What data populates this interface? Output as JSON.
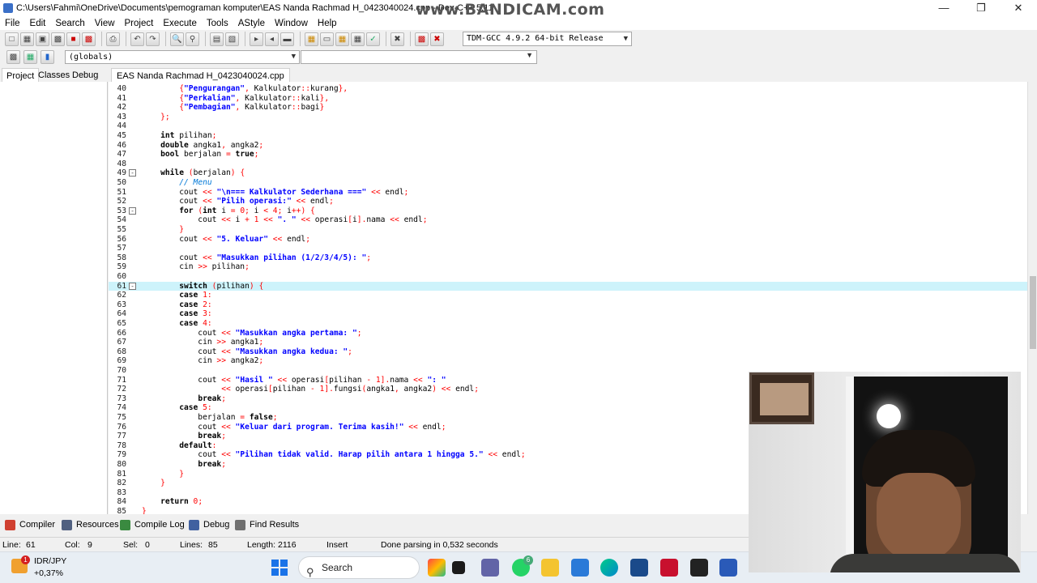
{
  "window": {
    "title": "C:\\Users\\Fahmi\\OneDrive\\Documents\\pemograman komputer\\EAS Nanda Rachmad H_0423040024.cpp - Dev-C++ 5.11",
    "watermark": "www.BANDICAM.com"
  },
  "menu": [
    "File",
    "Edit",
    "Search",
    "View",
    "Project",
    "Execute",
    "Tools",
    "AStyle",
    "Window",
    "Help"
  ],
  "toolbar": {
    "compiler": "TDM-GCC 4.9.2 64-bit Release",
    "scope": "(globals)",
    "function": ""
  },
  "left_tabs": [
    "Project",
    "Classes",
    "Debug"
  ],
  "file_tab": "EAS Nanda Rachmad H_0423040024.cpp",
  "code_lines": [
    {
      "n": "40",
      "fold": "",
      "segs": [
        [
          "plain",
          "        "
        ],
        [
          "sym",
          "{"
        ],
        [
          "str",
          "\"Pengurangan\""
        ],
        [
          "sym",
          ", "
        ],
        [
          "plain",
          "Kalkulator"
        ],
        [
          "sym",
          "::"
        ],
        [
          "plain",
          "kurang"
        ],
        [
          "sym",
          "},"
        ]
      ]
    },
    {
      "n": "41",
      "fold": "",
      "segs": [
        [
          "plain",
          "        "
        ],
        [
          "sym",
          "{"
        ],
        [
          "str",
          "\"Perkalian\""
        ],
        [
          "sym",
          ", "
        ],
        [
          "plain",
          "Kalkulator"
        ],
        [
          "sym",
          "::"
        ],
        [
          "plain",
          "kali"
        ],
        [
          "sym",
          "},"
        ]
      ]
    },
    {
      "n": "42",
      "fold": "",
      "segs": [
        [
          "plain",
          "        "
        ],
        [
          "sym",
          "{"
        ],
        [
          "str",
          "\"Pembagian\""
        ],
        [
          "sym",
          ", "
        ],
        [
          "plain",
          "Kalkulator"
        ],
        [
          "sym",
          "::"
        ],
        [
          "plain",
          "bagi"
        ],
        [
          "sym",
          "}"
        ]
      ]
    },
    {
      "n": "43",
      "fold": "",
      "segs": [
        [
          "plain",
          "    "
        ],
        [
          "sym",
          "};"
        ]
      ]
    },
    {
      "n": "44",
      "fold": "",
      "segs": []
    },
    {
      "n": "45",
      "fold": "",
      "segs": [
        [
          "plain",
          "    "
        ],
        [
          "kw",
          "int"
        ],
        [
          "plain",
          " pilihan"
        ],
        [
          "sym",
          ";"
        ]
      ]
    },
    {
      "n": "46",
      "fold": "",
      "segs": [
        [
          "plain",
          "    "
        ],
        [
          "kw",
          "double"
        ],
        [
          "plain",
          " angka1"
        ],
        [
          "sym",
          ", "
        ],
        [
          "plain",
          "angka2"
        ],
        [
          "sym",
          ";"
        ]
      ]
    },
    {
      "n": "47",
      "fold": "",
      "segs": [
        [
          "plain",
          "    "
        ],
        [
          "kw",
          "bool"
        ],
        [
          "plain",
          " berjalan "
        ],
        [
          "sym",
          "="
        ],
        [
          "plain",
          " "
        ],
        [
          "kw",
          "true"
        ],
        [
          "sym",
          ";"
        ]
      ]
    },
    {
      "n": "48",
      "fold": "",
      "segs": []
    },
    {
      "n": "49",
      "fold": "-",
      "segs": [
        [
          "plain",
          "    "
        ],
        [
          "kw",
          "while"
        ],
        [
          "plain",
          " "
        ],
        [
          "sym",
          "("
        ],
        [
          "plain",
          "berjalan"
        ],
        [
          "sym",
          ")"
        ],
        [
          "plain",
          " "
        ],
        [
          "sym",
          "{"
        ]
      ]
    },
    {
      "n": "50",
      "fold": "",
      "segs": [
        [
          "plain",
          "        "
        ],
        [
          "cmt",
          "// Menu"
        ]
      ]
    },
    {
      "n": "51",
      "fold": "",
      "segs": [
        [
          "plain",
          "        cout "
        ],
        [
          "sym",
          "<<"
        ],
        [
          "plain",
          " "
        ],
        [
          "str",
          "\"\\n=== Kalkulator Sederhana ===\""
        ],
        [
          "plain",
          " "
        ],
        [
          "sym",
          "<<"
        ],
        [
          "plain",
          " endl"
        ],
        [
          "sym",
          ";"
        ]
      ]
    },
    {
      "n": "52",
      "fold": "",
      "segs": [
        [
          "plain",
          "        cout "
        ],
        [
          "sym",
          "<<"
        ],
        [
          "plain",
          " "
        ],
        [
          "str",
          "\"Pilih operasi:\""
        ],
        [
          "plain",
          " "
        ],
        [
          "sym",
          "<<"
        ],
        [
          "plain",
          " endl"
        ],
        [
          "sym",
          ";"
        ]
      ]
    },
    {
      "n": "53",
      "fold": "-",
      "segs": [
        [
          "plain",
          "        "
        ],
        [
          "kw",
          "for"
        ],
        [
          "plain",
          " "
        ],
        [
          "sym",
          "("
        ],
        [
          "kw",
          "int"
        ],
        [
          "plain",
          " i "
        ],
        [
          "sym",
          "="
        ],
        [
          "plain",
          " "
        ],
        [
          "num",
          "0"
        ],
        [
          "sym",
          ";"
        ],
        [
          "plain",
          " i "
        ],
        [
          "sym",
          "<"
        ],
        [
          "plain",
          " "
        ],
        [
          "num",
          "4"
        ],
        [
          "sym",
          ";"
        ],
        [
          "plain",
          " i"
        ],
        [
          "sym",
          "++)"
        ],
        [
          "plain",
          " "
        ],
        [
          "sym",
          "{"
        ]
      ]
    },
    {
      "n": "54",
      "fold": "",
      "segs": [
        [
          "plain",
          "            cout "
        ],
        [
          "sym",
          "<<"
        ],
        [
          "plain",
          " i "
        ],
        [
          "sym",
          "+"
        ],
        [
          "plain",
          " "
        ],
        [
          "num",
          "1"
        ],
        [
          "plain",
          " "
        ],
        [
          "sym",
          "<<"
        ],
        [
          "plain",
          " "
        ],
        [
          "str",
          "\". \""
        ],
        [
          "plain",
          " "
        ],
        [
          "sym",
          "<<"
        ],
        [
          "plain",
          " operasi"
        ],
        [
          "sym",
          "["
        ],
        [
          "plain",
          "i"
        ],
        [
          "sym",
          "]."
        ],
        [
          "plain",
          "nama "
        ],
        [
          "sym",
          "<<"
        ],
        [
          "plain",
          " endl"
        ],
        [
          "sym",
          ";"
        ]
      ]
    },
    {
      "n": "55",
      "fold": "",
      "segs": [
        [
          "plain",
          "        "
        ],
        [
          "sym",
          "}"
        ]
      ]
    },
    {
      "n": "56",
      "fold": "",
      "segs": [
        [
          "plain",
          "        cout "
        ],
        [
          "sym",
          "<<"
        ],
        [
          "plain",
          " "
        ],
        [
          "str",
          "\"5. Keluar\""
        ],
        [
          "plain",
          " "
        ],
        [
          "sym",
          "<<"
        ],
        [
          "plain",
          " endl"
        ],
        [
          "sym",
          ";"
        ]
      ]
    },
    {
      "n": "57",
      "fold": "",
      "segs": []
    },
    {
      "n": "58",
      "fold": "",
      "segs": [
        [
          "plain",
          "        cout "
        ],
        [
          "sym",
          "<<"
        ],
        [
          "plain",
          " "
        ],
        [
          "str",
          "\"Masukkan pilihan (1/2/3/4/5): \""
        ],
        [
          "sym",
          ";"
        ]
      ]
    },
    {
      "n": "59",
      "fold": "",
      "segs": [
        [
          "plain",
          "        cin "
        ],
        [
          "sym",
          ">>"
        ],
        [
          "plain",
          " pilihan"
        ],
        [
          "sym",
          ";"
        ]
      ]
    },
    {
      "n": "60",
      "fold": "",
      "segs": []
    },
    {
      "n": "61",
      "fold": "-",
      "cur": true,
      "segs": [
        [
          "plain",
          "        "
        ],
        [
          "kw",
          "switch"
        ],
        [
          "plain",
          " "
        ],
        [
          "sym",
          "("
        ],
        [
          "plain",
          "pilihan"
        ],
        [
          "sym",
          ")"
        ],
        [
          "plain",
          " "
        ],
        [
          "sym",
          "{"
        ]
      ]
    },
    {
      "n": "62",
      "fold": "",
      "segs": [
        [
          "plain",
          "        "
        ],
        [
          "kw",
          "case"
        ],
        [
          "plain",
          " "
        ],
        [
          "num",
          "1"
        ],
        [
          "sym",
          ":"
        ]
      ]
    },
    {
      "n": "63",
      "fold": "",
      "segs": [
        [
          "plain",
          "        "
        ],
        [
          "kw",
          "case"
        ],
        [
          "plain",
          " "
        ],
        [
          "num",
          "2"
        ],
        [
          "sym",
          ":"
        ]
      ]
    },
    {
      "n": "64",
      "fold": "",
      "segs": [
        [
          "plain",
          "        "
        ],
        [
          "kw",
          "case"
        ],
        [
          "plain",
          " "
        ],
        [
          "num",
          "3"
        ],
        [
          "sym",
          ":"
        ]
      ]
    },
    {
      "n": "65",
      "fold": "",
      "segs": [
        [
          "plain",
          "        "
        ],
        [
          "kw",
          "case"
        ],
        [
          "plain",
          " "
        ],
        [
          "num",
          "4"
        ],
        [
          "sym",
          ":"
        ]
      ]
    },
    {
      "n": "66",
      "fold": "",
      "segs": [
        [
          "plain",
          "            cout "
        ],
        [
          "sym",
          "<<"
        ],
        [
          "plain",
          " "
        ],
        [
          "str",
          "\"Masukkan angka pertama: \""
        ],
        [
          "sym",
          ";"
        ]
      ]
    },
    {
      "n": "67",
      "fold": "",
      "segs": [
        [
          "plain",
          "            cin "
        ],
        [
          "sym",
          ">>"
        ],
        [
          "plain",
          " angka1"
        ],
        [
          "sym",
          ";"
        ]
      ]
    },
    {
      "n": "68",
      "fold": "",
      "segs": [
        [
          "plain",
          "            cout "
        ],
        [
          "sym",
          "<<"
        ],
        [
          "plain",
          " "
        ],
        [
          "str",
          "\"Masukkan angka kedua: \""
        ],
        [
          "sym",
          ";"
        ]
      ]
    },
    {
      "n": "69",
      "fold": "",
      "segs": [
        [
          "plain",
          "            cin "
        ],
        [
          "sym",
          ">>"
        ],
        [
          "plain",
          " angka2"
        ],
        [
          "sym",
          ";"
        ]
      ]
    },
    {
      "n": "70",
      "fold": "",
      "segs": []
    },
    {
      "n": "71",
      "fold": "",
      "segs": [
        [
          "plain",
          "            cout "
        ],
        [
          "sym",
          "<<"
        ],
        [
          "plain",
          " "
        ],
        [
          "str",
          "\"Hasil \""
        ],
        [
          "plain",
          " "
        ],
        [
          "sym",
          "<<"
        ],
        [
          "plain",
          " operasi"
        ],
        [
          "sym",
          "["
        ],
        [
          "plain",
          "pilihan "
        ],
        [
          "sym",
          "-"
        ],
        [
          "plain",
          " "
        ],
        [
          "num",
          "1"
        ],
        [
          "sym",
          "]."
        ],
        [
          "plain",
          "nama "
        ],
        [
          "sym",
          "<<"
        ],
        [
          "plain",
          " "
        ],
        [
          "str",
          "\": \""
        ]
      ]
    },
    {
      "n": "72",
      "fold": "",
      "segs": [
        [
          "plain",
          "                 "
        ],
        [
          "sym",
          "<<"
        ],
        [
          "plain",
          " operasi"
        ],
        [
          "sym",
          "["
        ],
        [
          "plain",
          "pilihan "
        ],
        [
          "sym",
          "-"
        ],
        [
          "plain",
          " "
        ],
        [
          "num",
          "1"
        ],
        [
          "sym",
          "]."
        ],
        [
          "plain",
          "fungsi"
        ],
        [
          "sym",
          "("
        ],
        [
          "plain",
          "angka1"
        ],
        [
          "sym",
          ","
        ],
        [
          "plain",
          " angka2"
        ],
        [
          "sym",
          ")"
        ],
        [
          "plain",
          " "
        ],
        [
          "sym",
          "<<"
        ],
        [
          "plain",
          " endl"
        ],
        [
          "sym",
          ";"
        ]
      ]
    },
    {
      "n": "73",
      "fold": "",
      "segs": [
        [
          "plain",
          "            "
        ],
        [
          "kw",
          "break"
        ],
        [
          "sym",
          ";"
        ]
      ]
    },
    {
      "n": "74",
      "fold": "",
      "segs": [
        [
          "plain",
          "        "
        ],
        [
          "kw",
          "case"
        ],
        [
          "plain",
          " "
        ],
        [
          "num",
          "5"
        ],
        [
          "sym",
          ":"
        ]
      ]
    },
    {
      "n": "75",
      "fold": "",
      "segs": [
        [
          "plain",
          "            berjalan "
        ],
        [
          "sym",
          "="
        ],
        [
          "plain",
          " "
        ],
        [
          "kw",
          "false"
        ],
        [
          "sym",
          ";"
        ]
      ]
    },
    {
      "n": "76",
      "fold": "",
      "segs": [
        [
          "plain",
          "            cout "
        ],
        [
          "sym",
          "<<"
        ],
        [
          "plain",
          " "
        ],
        [
          "str",
          "\"Keluar dari program. Terima kasih!\""
        ],
        [
          "plain",
          " "
        ],
        [
          "sym",
          "<<"
        ],
        [
          "plain",
          " endl"
        ],
        [
          "sym",
          ";"
        ]
      ]
    },
    {
      "n": "77",
      "fold": "",
      "segs": [
        [
          "plain",
          "            "
        ],
        [
          "kw",
          "break"
        ],
        [
          "sym",
          ";"
        ]
      ]
    },
    {
      "n": "78",
      "fold": "",
      "segs": [
        [
          "plain",
          "        "
        ],
        [
          "kw",
          "default"
        ],
        [
          "sym",
          ":"
        ]
      ]
    },
    {
      "n": "79",
      "fold": "",
      "segs": [
        [
          "plain",
          "            cout "
        ],
        [
          "sym",
          "<<"
        ],
        [
          "plain",
          " "
        ],
        [
          "str",
          "\"Pilihan tidak valid. Harap pilih antara 1 hingga 5.\""
        ],
        [
          "plain",
          " "
        ],
        [
          "sym",
          "<<"
        ],
        [
          "plain",
          " endl"
        ],
        [
          "sym",
          ";"
        ]
      ]
    },
    {
      "n": "80",
      "fold": "",
      "segs": [
        [
          "plain",
          "            "
        ],
        [
          "kw",
          "break"
        ],
        [
          "sym",
          ";"
        ]
      ]
    },
    {
      "n": "81",
      "fold": "",
      "segs": [
        [
          "plain",
          "        "
        ],
        [
          "sym",
          "}"
        ]
      ]
    },
    {
      "n": "82",
      "fold": "",
      "segs": [
        [
          "plain",
          "    "
        ],
        [
          "sym",
          "}"
        ]
      ]
    },
    {
      "n": "83",
      "fold": "",
      "segs": []
    },
    {
      "n": "84",
      "fold": "",
      "segs": [
        [
          "plain",
          "    "
        ],
        [
          "kw",
          "return"
        ],
        [
          "plain",
          " "
        ],
        [
          "num",
          "0"
        ],
        [
          "sym",
          ";"
        ]
      ]
    },
    {
      "n": "85",
      "fold": "",
      "segs": [
        [
          "sym",
          "}"
        ]
      ]
    }
  ],
  "bottom_tabs": [
    "Compiler",
    "Resources",
    "Compile Log",
    "Debug",
    "Find Results"
  ],
  "status": {
    "line_label": "Line:",
    "line": "61",
    "col_label": "Col:",
    "col": "9",
    "sel_label": "Sel:",
    "sel": "0",
    "lines_label": "Lines:",
    "lines": "85",
    "length_label": "Length:",
    "length": "2116",
    "mode": "Insert",
    "message": "Done parsing in 0,532 seconds"
  },
  "taskbar": {
    "ticker_pair": "IDR/JPY",
    "ticker_delta": "+0,37%",
    "ticker_badge": "1",
    "search": "Search",
    "whatsapp_badge": "6"
  },
  "colors": {
    "current_line": "#cdf3fb",
    "string": "#0000ff",
    "number": "#ff0000",
    "comment": "#0078d7"
  }
}
